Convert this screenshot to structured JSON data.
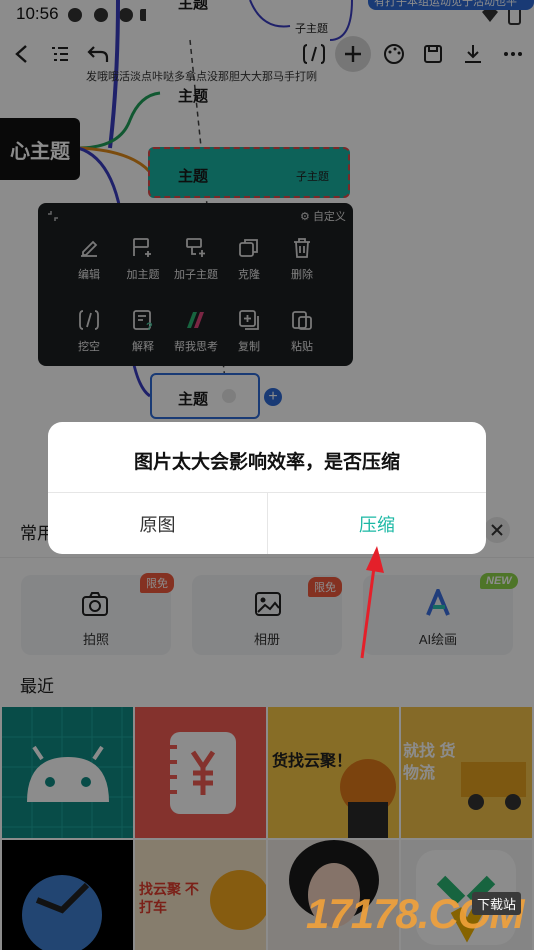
{
  "status_bar": {
    "time": "10:56"
  },
  "toolbar": {
    "back": "back-icon",
    "outline": "outline-icon",
    "undo": "undo-icon",
    "fill_blank": "fill-blank-icon",
    "add": "add-icon",
    "palette": "palette-icon",
    "save": "save-icon",
    "download": "download-icon",
    "more": "more-icon"
  },
  "mindmap": {
    "central_node": "心主题",
    "top_node": "主题",
    "top_sub": "子主题",
    "top_right_note": "有打子本组运动见于活动也平",
    "note": "发哦哦活淡点咔哒多拿点没那胆大大那马手打咧",
    "node_1": "主题",
    "node_2": "主题",
    "node_2_sub": "子主题",
    "node_3": "主题"
  },
  "context_menu": {
    "customize": "自定义",
    "row1": [
      "编辑",
      "加主题",
      "加子主题",
      "克隆",
      "删除"
    ],
    "row2": [
      "挖空",
      "解释",
      "帮我思考",
      "复制",
      "粘贴"
    ]
  },
  "sheet": {
    "tab_common": "常用",
    "sources": [
      {
        "label": "拍照",
        "badge": "限免",
        "icon": "camera-icon"
      },
      {
        "label": "相册",
        "badge": "限免",
        "icon": "gallery-icon"
      },
      {
        "label": "AI绘画",
        "badge": "NEW",
        "icon": "ai-paint-icon"
      }
    ],
    "recent_title": "最近",
    "thumbnails": [
      {
        "name": "android-thumb",
        "text": ""
      },
      {
        "name": "ledger-thumb",
        "text": ""
      },
      {
        "name": "delivery-ad-thumb",
        "text": "货找云聚！"
      },
      {
        "name": "logistics-ad-thumb",
        "text": "就找 货物流"
      },
      {
        "name": "bird-sky-thumb",
        "text": ""
      },
      {
        "name": "promo-thumb",
        "text": "找云聚 不打车"
      },
      {
        "name": "portrait-thumb",
        "text": ""
      },
      {
        "name": "app-logo-thumb",
        "text": ""
      }
    ]
  },
  "dialog": {
    "title": "图片太大会影响效率，是否压缩",
    "cancel": "原图",
    "confirm": "压缩"
  },
  "watermark": {
    "text": "17178.COM",
    "badge": "下载站"
  },
  "colors": {
    "accent": "#1bb8a4",
    "node_fill": "#19b3a3",
    "badge": "#f05a3c",
    "arrow": "#e4202a",
    "new_badge": "#8fd64a"
  }
}
